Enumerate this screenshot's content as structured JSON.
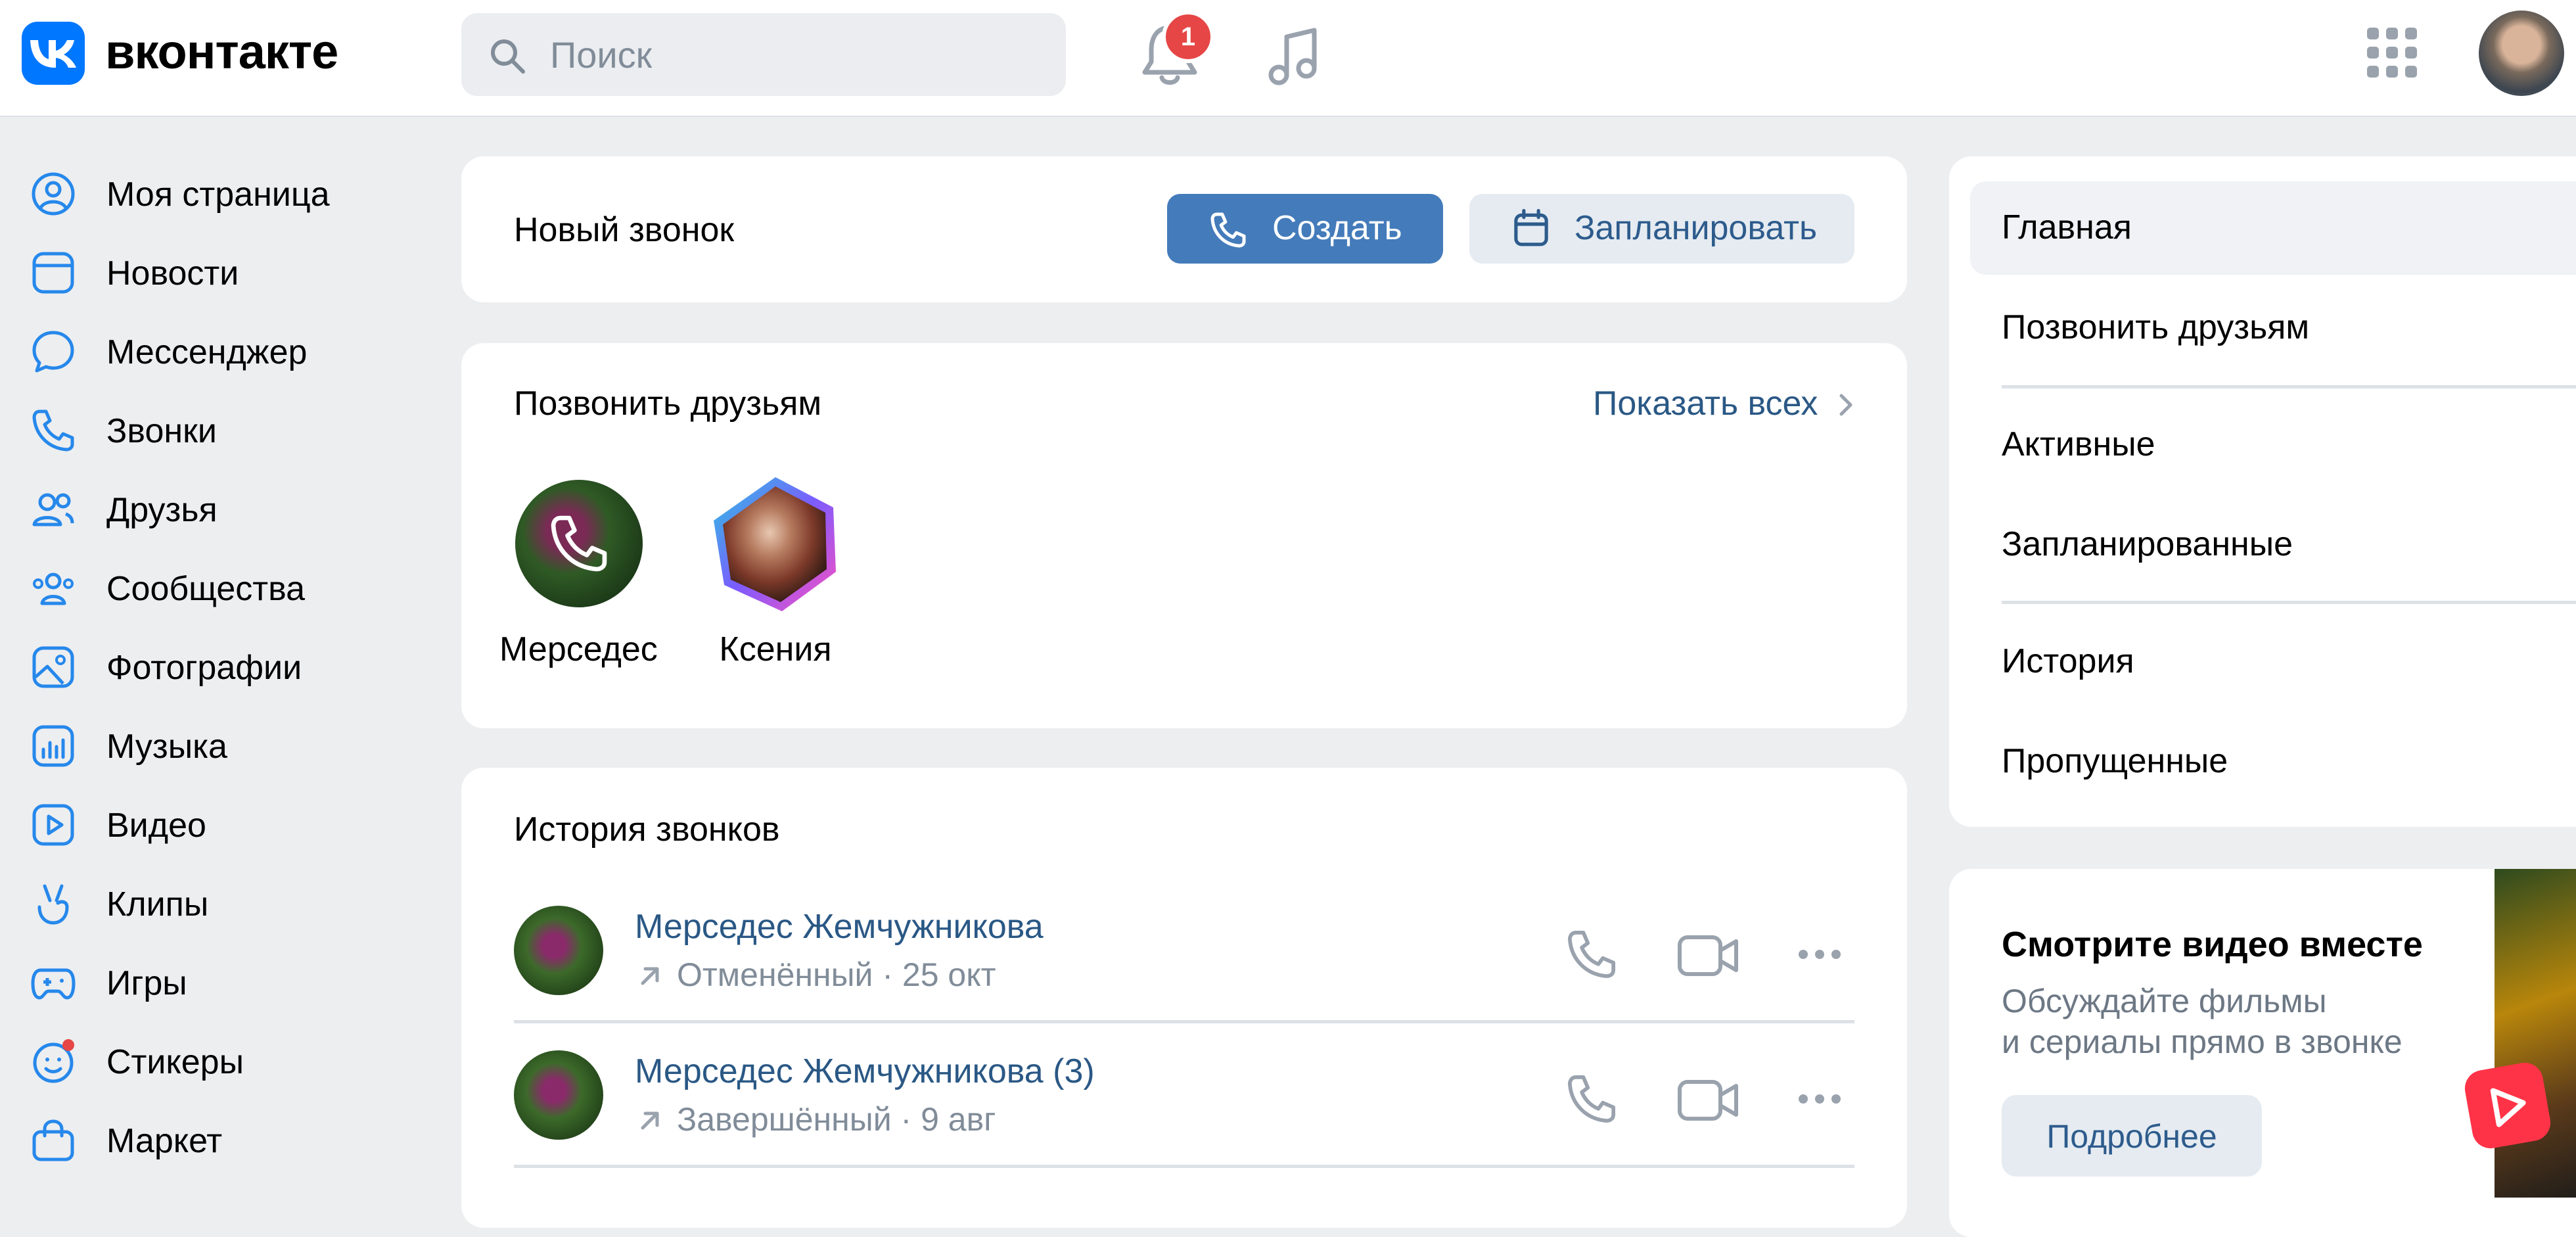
{
  "header": {
    "logo_text": "вконтакте",
    "search_placeholder": "Поиск",
    "notifications_count": "1"
  },
  "sidebar": {
    "items": [
      {
        "label": "Моя страница",
        "icon": "user-circle-icon"
      },
      {
        "label": "Новости",
        "icon": "news-icon"
      },
      {
        "label": "Мессенджер",
        "icon": "message-icon"
      },
      {
        "label": "Звонки",
        "icon": "phone-icon"
      },
      {
        "label": "Друзья",
        "icon": "friends-icon"
      },
      {
        "label": "Сообщества",
        "icon": "communities-icon"
      },
      {
        "label": "Фотографии",
        "icon": "photos-icon"
      },
      {
        "label": "Музыка",
        "icon": "music-icon"
      },
      {
        "label": "Видео",
        "icon": "video-icon"
      },
      {
        "label": "Клипы",
        "icon": "clips-icon"
      },
      {
        "label": "Игры",
        "icon": "games-icon"
      },
      {
        "label": "Стикеры",
        "icon": "stickers-icon"
      },
      {
        "label": "Маркет",
        "icon": "market-icon"
      }
    ]
  },
  "new_call": {
    "title": "Новый звонок",
    "create_label": "Создать",
    "schedule_label": "Запланировать"
  },
  "call_friends": {
    "title": "Позвонить друзьям",
    "show_all": "Показать всех",
    "friends": [
      {
        "name": "Мерседес"
      },
      {
        "name": "Ксения"
      }
    ]
  },
  "history": {
    "title": "История звонков",
    "rows": [
      {
        "name": "Мерседес Жемчужникова",
        "status": "Отменённый · 25 окт"
      },
      {
        "name": "Мерседес Жемчужникова (3)",
        "status": "Завершённый · 9 авг"
      }
    ]
  },
  "right_menu": {
    "items": [
      "Главная",
      "Позвонить друзьям",
      "Активные",
      "Запланированные",
      "История",
      "Пропущенные"
    ]
  },
  "promo": {
    "title": "Смотрите видео вместе",
    "text_line1": "Обсуждайте фильмы",
    "text_line2": "и сериалы прямо в звонке",
    "button": "Подробнее"
  },
  "colors": {
    "accent": "#447bba",
    "link": "#2a5885",
    "icon": "#2688eb",
    "badge": "#e64646",
    "background": "#edeef0"
  }
}
